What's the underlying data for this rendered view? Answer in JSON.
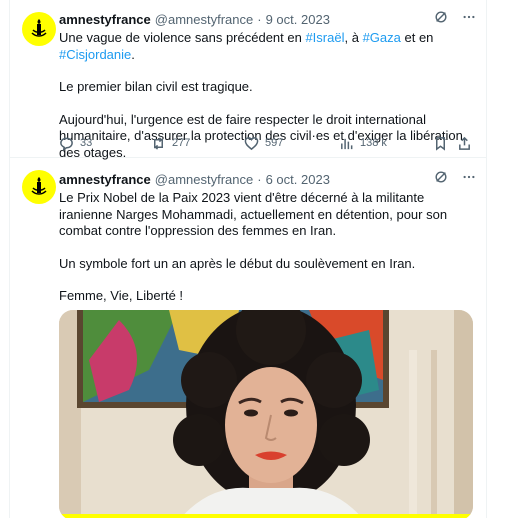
{
  "tweets": [
    {
      "author_name": "amnestyfrance",
      "handle": "@amnestyfrance",
      "separator": "·",
      "date": "9 oct. 2023",
      "paragraph1": {
        "t1": "Une vague de violence sans précédent en ",
        "h1": "#Israël",
        "t2": ", à ",
        "h2": "#Gaza",
        "t3": " et en ",
        "h3": "#Cisjordanie",
        "t4": "."
      },
      "paragraph2": "Le premier bilan civil est tragique.",
      "paragraph3": "Aujourd'hui, l'urgence est de faire respecter le droit international humanitaire, d'assurer la protection des civil·es et d'exiger la libération des otages.",
      "replies": "33",
      "reposts": "277",
      "likes": "597",
      "views": "138 k"
    },
    {
      "author_name": "amnestyfrance",
      "handle": "@amnestyfrance",
      "separator": "·",
      "date": "6 oct. 2023",
      "paragraph1": "Le Prix Nobel de la Paix 2023 vient d'être décerné à la militante iranienne Narges Mohammadi, actuellement en détention, pour son combat contre l'oppression des femmes en Iran.",
      "paragraph2": "Un symbole fort un an après le début du soulèvement en Iran.",
      "paragraph3": "Femme, Vie, Liberté !"
    }
  ],
  "colors": {
    "accent": "#1d9bf0",
    "avatar_bg": "#ffff00",
    "secondary_text": "#536471"
  },
  "icons": [
    "candle-logo-icon",
    "grok-icon",
    "more-icon",
    "reply-icon",
    "repost-icon",
    "like-icon",
    "views-icon",
    "bookmark-icon",
    "share-icon"
  ]
}
